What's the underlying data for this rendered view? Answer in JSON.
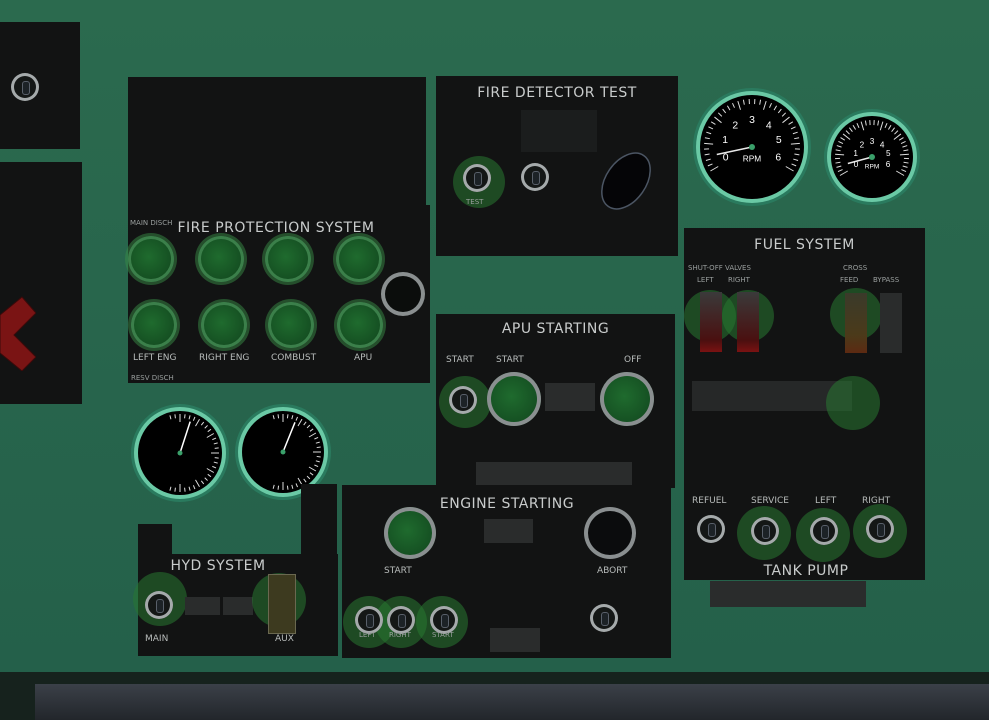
{
  "fire_detector": {
    "title": "FIRE DETECTOR TEST",
    "test_label": "TEST"
  },
  "fire_protection": {
    "title": "FIRE PROTECTION SYSTEM",
    "main_disch": "MAIN DISCH",
    "resv_disch": "RESV DISCH",
    "labels": [
      "LEFT ENG",
      "RIGHT ENG",
      "COMBUST",
      "APU"
    ]
  },
  "apu_starting": {
    "title": "APU STARTING",
    "start1": "START",
    "start2": "START",
    "off": "OFF"
  },
  "engine_starting": {
    "title": "ENGINE STARTING",
    "start": "START",
    "abort": "ABORT",
    "left": "LEFT",
    "right": "RIGHT",
    "start_small": "START"
  },
  "hyd_system": {
    "title": "HYD SYSTEM",
    "main": "MAIN",
    "aux": "AUX"
  },
  "fuel_system": {
    "title": "FUEL SYSTEM",
    "shutoff_valves": "SHUT-OFF VALVES",
    "left": "LEFT",
    "right": "RIGHT",
    "cross": "CROSS",
    "feed": "FEED",
    "bypass": "BYPASS",
    "pumps": [
      "REFUEL",
      "SERVICE",
      "LEFT",
      "RIGHT"
    ],
    "tank_pump": "TANK PUMP"
  },
  "rpm_gauges": {
    "large": {
      "label": "RPM",
      "ticks": [
        "0",
        "1",
        "2",
        "3",
        "4",
        "5",
        "6"
      ]
    },
    "small": {
      "label": "RPM",
      "ticks": [
        "0",
        "1",
        "2",
        "3",
        "4",
        "5",
        "6"
      ]
    }
  }
}
